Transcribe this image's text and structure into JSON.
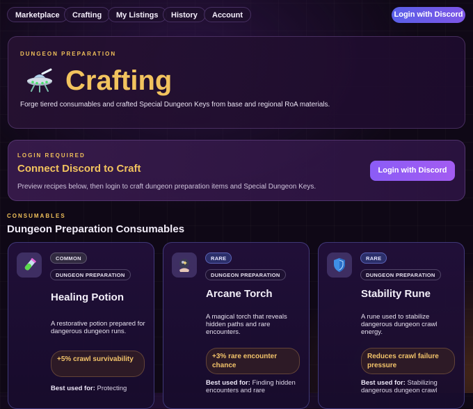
{
  "nav": {
    "items": [
      "Marketplace",
      "Crafting",
      "My Listings",
      "History",
      "Account"
    ],
    "discord_label": "Login with Discord"
  },
  "hero": {
    "eyebrow": "DUNGEON PREPARATION",
    "title": "Crafting",
    "description": "Forge tiered consumables and crafted Special Dungeon Keys from base and regional RoA materials.",
    "icon": "ufo-icon"
  },
  "login": {
    "eyebrow": "LOGIN REQUIRED",
    "title": "Connect Discord to Craft",
    "description": "Preview recipes below, then login to craft dungeon preparation items and Special Dungeon Keys.",
    "button_label": "Login with Discord"
  },
  "section": {
    "eyebrow": "CONSUMABLES",
    "title": "Dungeon Preparation Consumables"
  },
  "cards": [
    {
      "icon": "potion-icon",
      "rarity": "COMMON",
      "type": "DUNGEON PREPARATION",
      "name": "Healing Potion",
      "description": "A restorative potion prepared for dangerous dungeon runs.",
      "effect": "+5% crawl survivability",
      "best_label": "Best used for:",
      "best_text": " Protecting"
    },
    {
      "icon": "crystal-ball-icon",
      "rarity": "RARE",
      "type": "DUNGEON PREPARATION",
      "name": "Arcane Torch",
      "description": "A magical torch that reveals hidden paths and rare encounters.",
      "effect": "+3% rare encounter chance",
      "best_label": "Best used for:",
      "best_text": " Finding hidden encounters and rare"
    },
    {
      "icon": "shield-icon",
      "rarity": "RARE",
      "type": "DUNGEON PREPARATION",
      "name": "Stability Rune",
      "description": "A rune used to stabilize dangerous dungeon crawl energy.",
      "effect": "Reduces crawl failure pressure",
      "best_label": "Best used for:",
      "best_text": " Stabilizing dangerous dungeon crawl"
    }
  ],
  "colors": {
    "accent_gold": "#f2c35e",
    "discord_button": "#7d55e6",
    "background": "#0f0816"
  }
}
